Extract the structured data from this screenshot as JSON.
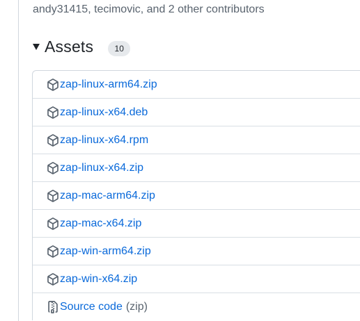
{
  "contributors_text": "andy31415, tecimovic, and 2 other contributors",
  "assets": {
    "title": "Assets",
    "count": "10",
    "items": [
      {
        "name": "zap-linux-arm64.zip",
        "icon": "package-icon"
      },
      {
        "name": "zap-linux-x64.deb",
        "icon": "package-icon"
      },
      {
        "name": "zap-linux-x64.rpm",
        "icon": "package-icon"
      },
      {
        "name": "zap-linux-x64.zip",
        "icon": "package-icon"
      },
      {
        "name": "zap-mac-arm64.zip",
        "icon": "package-icon"
      },
      {
        "name": "zap-mac-x64.zip",
        "icon": "package-icon"
      },
      {
        "name": "zap-win-arm64.zip",
        "icon": "package-icon"
      },
      {
        "name": "zap-win-x64.zip",
        "icon": "package-icon"
      }
    ],
    "source": {
      "name": "Source code",
      "suffix": "(zip)",
      "icon": "file-zip-icon"
    }
  },
  "colors": {
    "link": "#0969da",
    "muted_text": "#59636e",
    "border": "#d0d7de",
    "counter_bg": "#e6e9ec"
  }
}
